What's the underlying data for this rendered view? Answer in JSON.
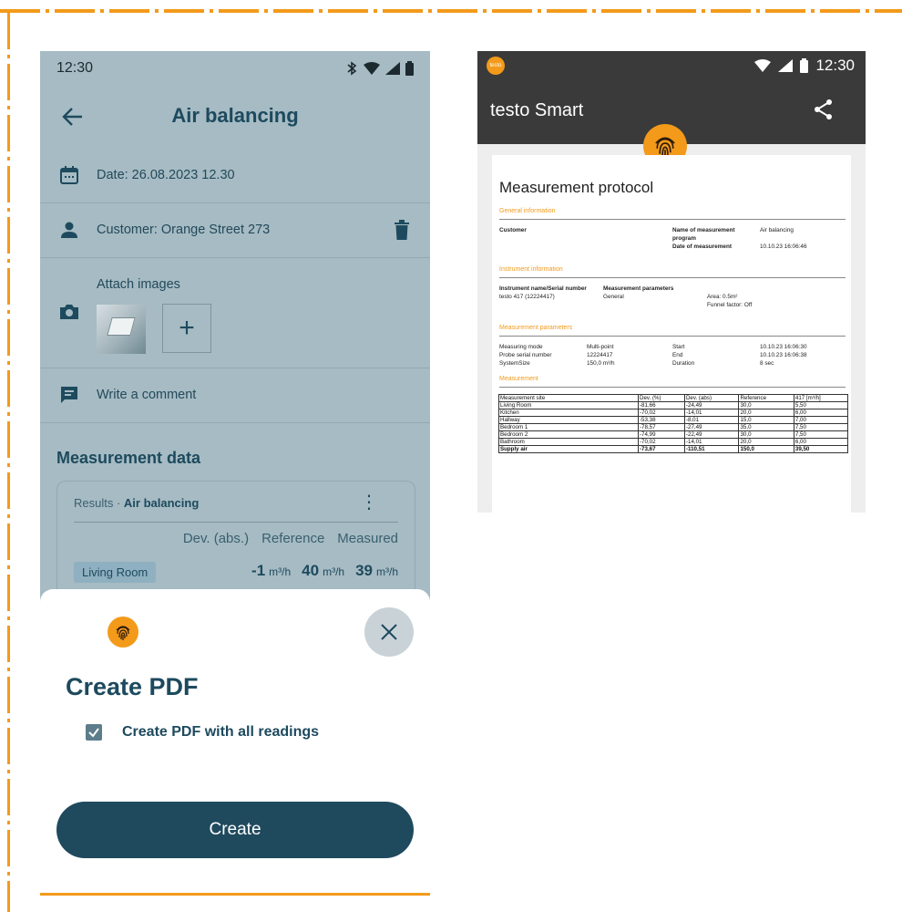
{
  "left": {
    "status": {
      "time": "12:30"
    },
    "appbar": {
      "title": "Air balancing"
    },
    "date_row": {
      "label": "Date: 26.08.2023 12.30"
    },
    "customer_row": {
      "label": "Customer: Orange Street 273"
    },
    "images_row": {
      "label": "Attach images",
      "add_label": "+"
    },
    "comment_row": {
      "label": "Write a comment"
    },
    "measurement": {
      "title": "Measurement data",
      "card": {
        "prefix": "Results · ",
        "name": "Air balancing",
        "columns": [
          "Dev. (abs.)",
          "Reference",
          "Measured"
        ],
        "row": {
          "site": "Living Room",
          "dev": "-1",
          "ref": "40",
          "meas": "39",
          "unit": "m³/h"
        }
      }
    },
    "sheet": {
      "title": "Create PDF",
      "checkbox_label": "Create PDF with all readings",
      "checkbox_checked": true,
      "create_label": "Create"
    }
  },
  "right": {
    "status": {
      "time": "12:30"
    },
    "logo_text": "testo",
    "app_title": "testo Smart",
    "doc": {
      "title": "Measurement protocol",
      "sec_general": "General information",
      "customer_label": "Customer",
      "program_label": "Name of measurement program",
      "program_value": "Air balancing",
      "date_label": "Date of measurement",
      "date_value": "10.10.23 16:06:46",
      "sec_instrument": "Instrument information",
      "instr_label": "Instrument name/Serial number",
      "instr_value": "testo 417 (12224417)",
      "params_label": "Measurement parameters",
      "params_value": "General",
      "area": "Area: 0.5m²",
      "funnel": "Funnel factor: Off",
      "sec_params": "Measurement parameters",
      "mode_label": "Measuring mode",
      "mode_value": "Multi-point",
      "probe_label": "Probe serial number",
      "probe_value": "12224417",
      "system_label": "SystemSize",
      "system_value": "150,0 m³/h",
      "start_label": "Start",
      "start_value": "10.10.23 16:06:30",
      "end_label": "End",
      "end_value": "10.10.23 16:06:38",
      "duration_label": "Duration",
      "duration_value": "8 sec",
      "sec_measurement": "Measurement",
      "table_header": [
        "Measurement site",
        "Dev. (%)",
        "Dev. (abs)",
        "Reference",
        "417 [m³/h]"
      ],
      "table_rows": [
        [
          "Living Room",
          "-81,66",
          "-24,49",
          "30,0",
          "5,50"
        ],
        [
          "Kitchen",
          "-70,02",
          "-14,01",
          "20,0",
          "6,00"
        ],
        [
          "Hallway",
          "-53,38",
          "-8,01",
          "15,0",
          "7,00"
        ],
        [
          "Bedroom 1",
          "-78,57",
          "-27,49",
          "35,0",
          "7,50"
        ],
        [
          "Bedroom 2",
          "-74,99",
          "-22,49",
          "30,0",
          "7,50"
        ],
        [
          "Bathroom",
          "-70,02",
          "-14,01",
          "20,0",
          "6,00"
        ],
        [
          "Supply air",
          "-73,67",
          "-110,51",
          "150,0",
          "39,50"
        ]
      ]
    }
  },
  "colors": {
    "accent": "#f39a1a",
    "primary": "#1f4a5e",
    "overlay": "#a6bbc3"
  }
}
